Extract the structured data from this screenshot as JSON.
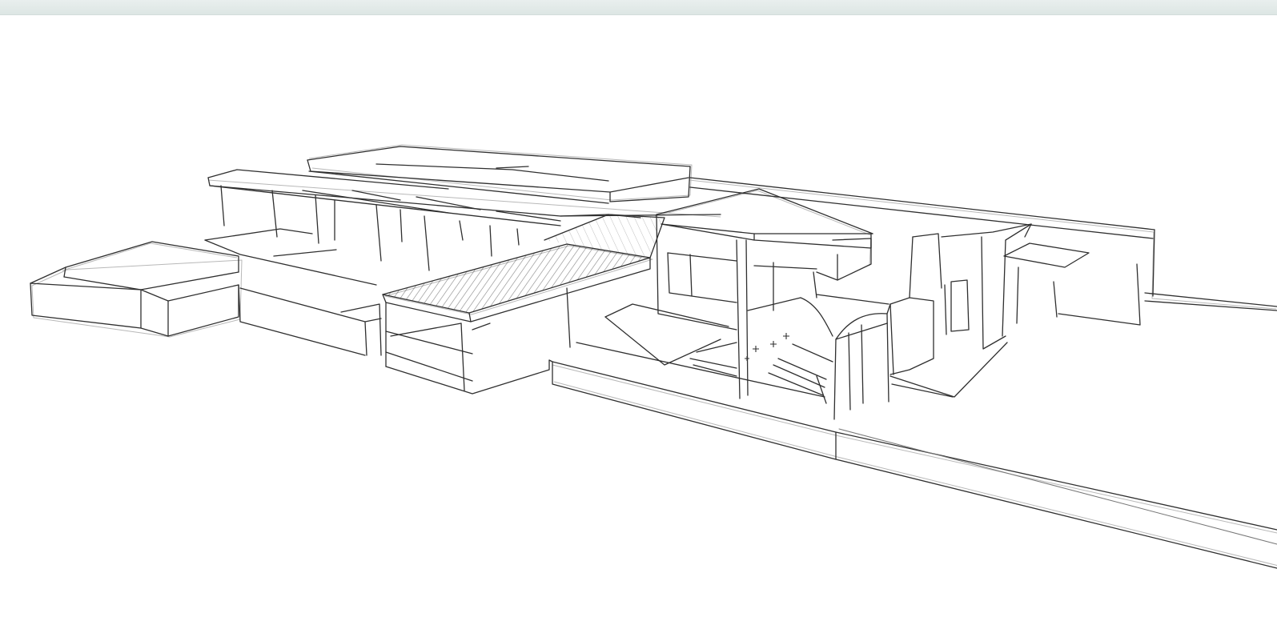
{
  "window": {
    "top_bar_color": "#e4ebea"
  },
  "viewport": {
    "background": "#ffffff",
    "style": "hand-drawn sketch edges",
    "subject": "modern-house-3d-model"
  },
  "colors": {
    "stroke": "#333333",
    "stroke_light": "#8a8a8a",
    "hatch": "#222222"
  }
}
